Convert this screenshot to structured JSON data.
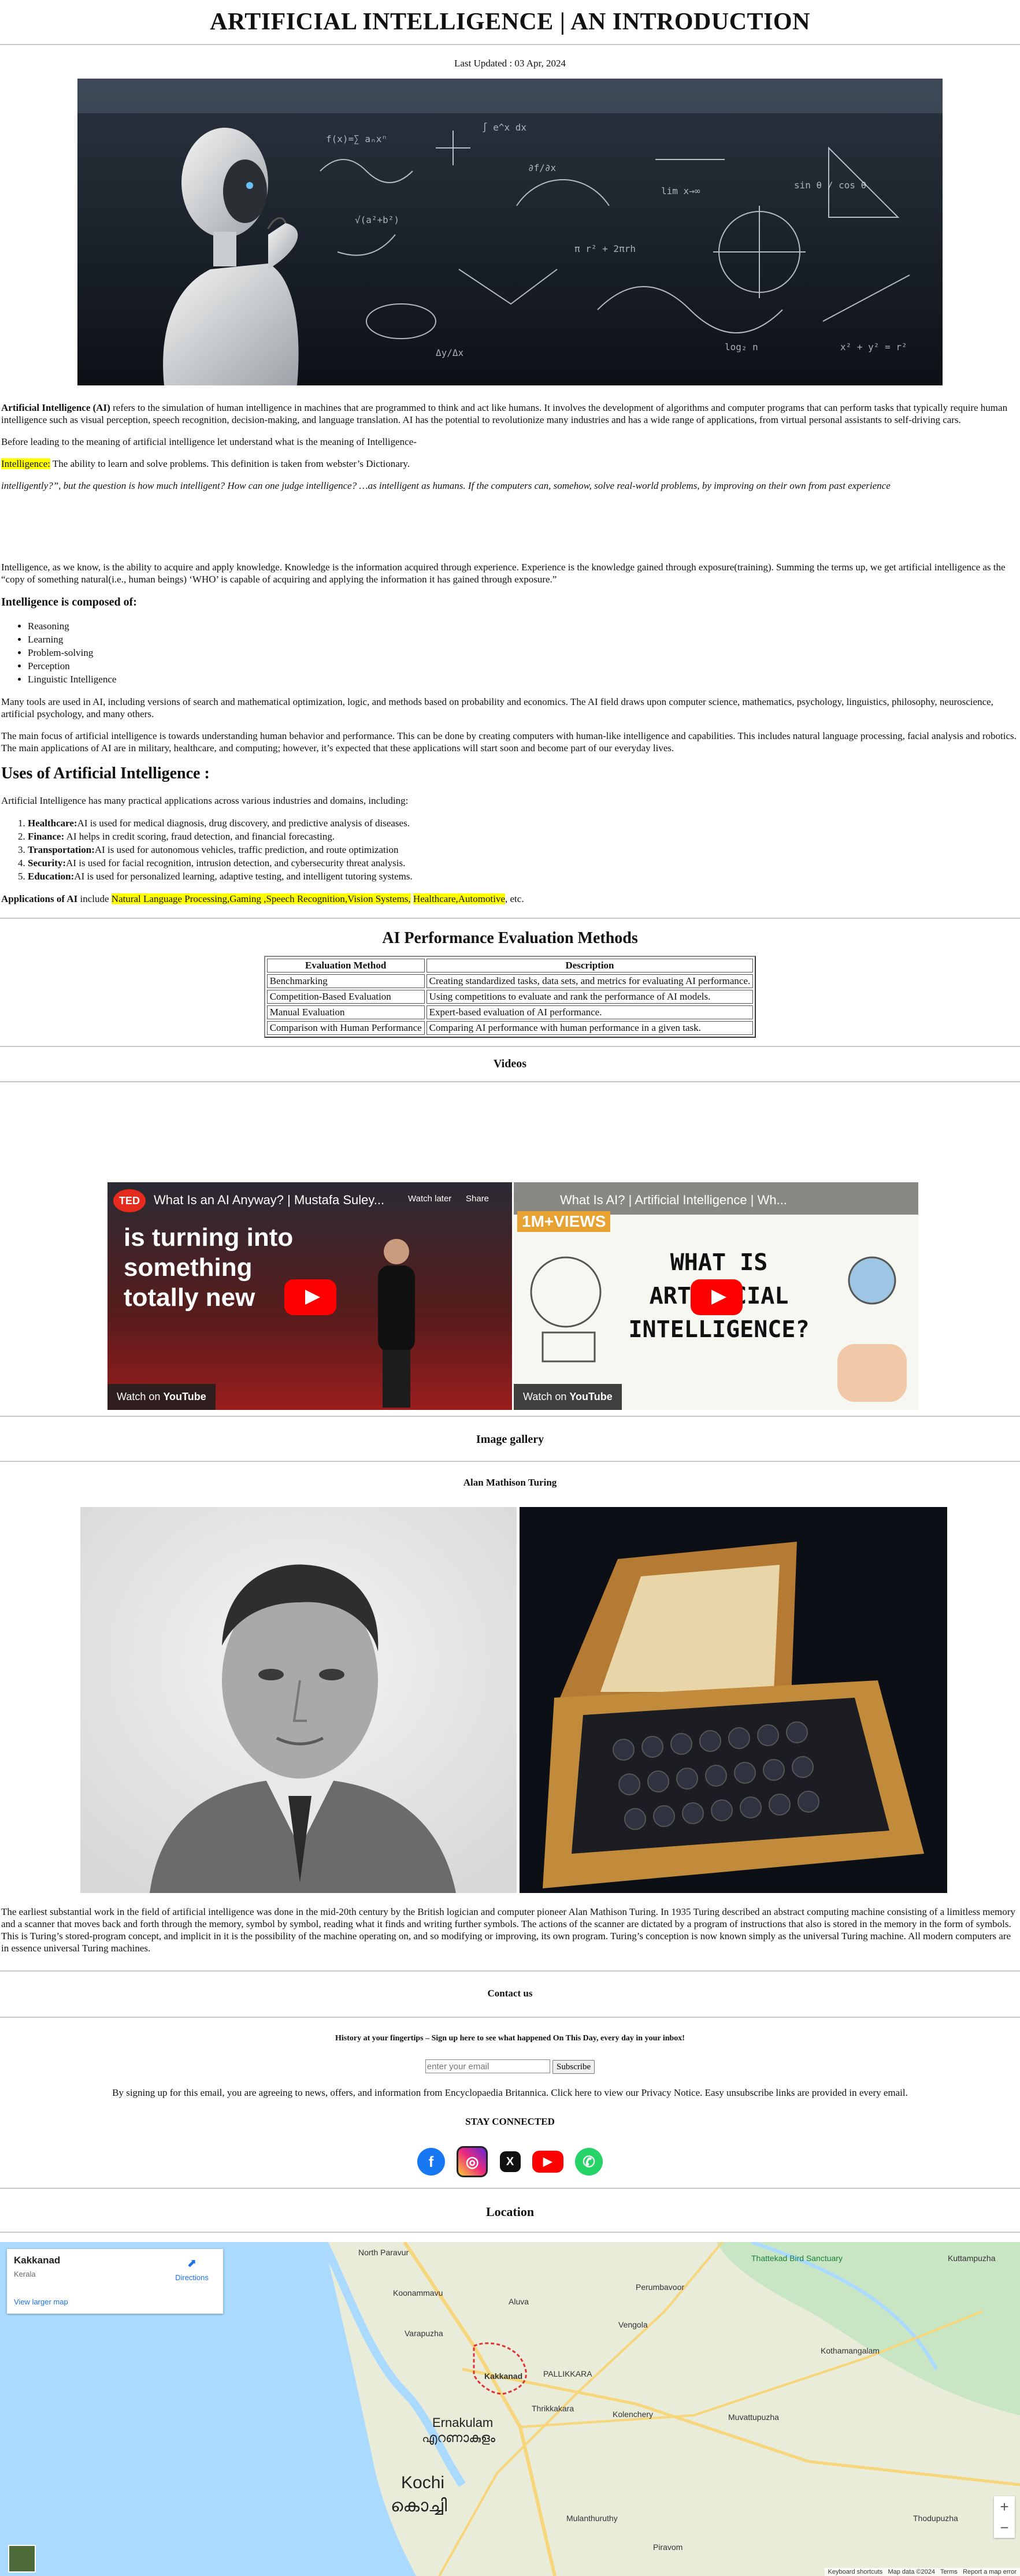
{
  "header": {
    "title": "ARTIFICIAL INTELLIGENCE | AN INTRODUCTION",
    "last_updated": "Last Updated : 03 Apr, 2024"
  },
  "intro": {
    "p1_bold": "Artificial Intelligence (AI)",
    "p1_rest": " refers to the simulation of human intelligence in machines that are programmed to think and act like humans. It involves the development of algorithms and computer programs that can perform tasks that typically require human intelligence such as visual perception, speech recognition, decision-making, and language translation. AI has the potential to revolutionize many industries and has a wide range of applications, from virtual personal assistants to self-driving cars.",
    "p2": "Before leading to the meaning of artificial intelligence let understand what is the meaning of Intelligence-",
    "p3_mark": "Intelligence:",
    "p3_rest": " The ability to learn and solve problems. This definition is taken from webster’s Dictionary.",
    "p4": "intelligently?”, but the question is how much intelligent? How can one judge intelligence? …as intelligent as humans. If the computers can, somehow, solve real-world problems, by improving on their own from past experience",
    "p5": "Intelligence, as we know, is the ability to acquire and apply knowledge. Knowledge is the information acquired through experience. Experience is the knowledge gained through exposure(training). Summing the terms up, we get artificial intelligence as the “copy of something natural(i.e., human beings) ‘WHO’ is capable of acquiring and applying the information it has gained through exposure.”"
  },
  "composed": {
    "heading": "Intelligence is composed of:",
    "items": [
      "Reasoning",
      "Learning",
      "Problem-solving",
      "Perception",
      "Linguistic Intelligence"
    ]
  },
  "tools": {
    "p1": "Many tools are used in AI, including versions of search and mathematical optimization, logic, and methods based on probability and economics. The AI field draws upon computer science, mathematics, psychology, linguistics, philosophy, neuroscience, artificial psychology, and many others.",
    "p2": "The main focus of artificial intelligence is towards understanding human behavior and performance. This can be done by creating computers with human-like intelligence and capabilities. This includes natural language processing, facial analysis and robotics. The main applications of AI are in military, healthcare, and computing; however, it’s expected that these applications will start soon and become part of our everyday lives."
  },
  "uses": {
    "heading": "Uses of Artificial Intelligence :",
    "intro": "Artificial Intelligence has many practical applications across various industries and domains, including:",
    "items": [
      {
        "label": "Healthcare:",
        "text": "AI is used for medical diagnosis, drug discovery, and predictive analysis of diseases."
      },
      {
        "label": "Finance:",
        "text": " AI helps in credit scoring, fraud detection, and financial forecasting."
      },
      {
        "label": "Transportation:",
        "text": "AI is used for autonomous vehicles, traffic prediction, and route optimization"
      },
      {
        "label": "Security:",
        "text": "AI is used for facial recognition, intrusion detection, and cybersecurity threat analysis."
      },
      {
        "label": "Education:",
        "text": "AI is used for personalized learning, adaptive testing, and intelligent tutoring systems."
      }
    ],
    "apps_bold": "Applications of AI",
    "apps_include": " include ",
    "apps_mark1": "Natural Language Processing,Gaming ,Speech Recognition,Vision Systems,",
    "apps_gap": " ",
    "apps_mark2": "Healthcare,Automotive",
    "apps_end": ", etc."
  },
  "performance": {
    "heading": "AI Performance Evaluation Methods",
    "headers": [
      "Evaluation Method",
      "Description"
    ],
    "rows": [
      [
        "Benchmarking",
        "Creating standardized tasks, data sets, and metrics for evaluating AI performance."
      ],
      [
        "Competition-Based Evaluation",
        "Using competitions to evaluate and rank the performance of AI models."
      ],
      [
        "Manual Evaluation",
        "Expert-based evaluation of AI performance."
      ],
      [
        "Comparison with Human Performance",
        "Comparing AI performance with human performance in a given task."
      ]
    ]
  },
  "videos": {
    "heading": "Videos",
    "items": [
      {
        "title": "What Is an AI Anyway? | Mustafa Suley...",
        "overlay": "is turning into something totally new",
        "watch_later": "Watch later",
        "share": "Share",
        "badge": "TED"
      },
      {
        "title": "What Is AI? | Artificial Intelligence | Wh...",
        "overlay": "WHAT IS ARTIFICIAL INTELLIGENCE?",
        "badge": "1M+VIEWS"
      }
    ],
    "watch_on": "Watch on",
    "youtube": "YouTube"
  },
  "gallery": {
    "heading": "Image gallery",
    "subheading": "Alan Mathison Turing",
    "paragraph": "The earliest substantial work in the field of artificial intelligence was done in the mid-20th century by the British logician and computer pioneer Alan Mathison Turing. In 1935 Turing described an abstract computing machine consisting of a limitless memory and a scanner that moves back and forth through the memory, symbol by symbol, reading what it finds and writing further symbols. The actions of the scanner are dictated by a program of instructions that also is stored in the memory in the form of symbols. This is Turing’s stored-program concept, and implicit in it is the possibility of the machine operating on, and so modifying or improving, its own program. Turing’s conception is now known simply as the universal Turing machine. All modern computers are in essence universal Turing machines."
  },
  "contact": {
    "heading": "Contact us",
    "history": "History at your fingertips – Sign up here to see what happened On This Day, every day in your inbox!",
    "email_placeholder": "enter your email",
    "subscribe": "Subscribe",
    "disclaimer": "By signing up for this email, you are agreeing to news, offers, and information from Encyclopaedia Britannica. Click here to view our Privacy Notice. Easy unsubscribe links are provided in every email.",
    "stay": "STAY CONNECTED",
    "social": [
      "facebook-icon",
      "instagram-icon",
      "x-icon",
      "youtube-icon",
      "whatsapp-icon"
    ]
  },
  "location": {
    "heading": "Location",
    "place": "Kakkanad",
    "region": "Kerala",
    "directions": "Directions",
    "larger_map": "View larger map",
    "labels": [
      "North Paravur",
      "Aluva",
      "Perumbavoor",
      "Kothamangalam",
      "Ernakulam",
      "എറണാകുളം",
      "Kochi",
      "കൊച്ചി",
      "Kakkanad",
      "PALLIKKARA",
      "Vengola",
      "Kolenchery",
      "Muvattupuzha",
      "Thattekad Bird Sanctuary",
      "Varapuzha",
      "Koonammavu",
      "Thrikkakara",
      "Piravom",
      "Mulanthuruthy",
      "Kuttampuzha",
      "Thodupuzha"
    ],
    "footer": [
      "Keyboard shortcuts",
      "Map data ©2024",
      "Terms",
      "Report a map error"
    ],
    "colors": {
      "land": "#e8ecd9",
      "water": "#aadaff",
      "forest": "#c8e6c4",
      "road": "#f7d57a"
    }
  }
}
